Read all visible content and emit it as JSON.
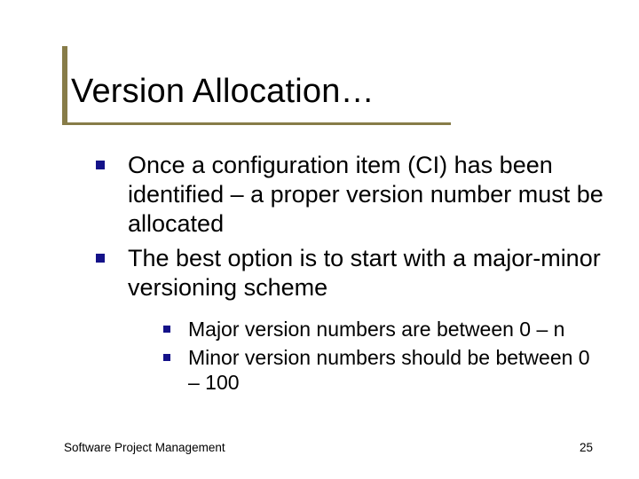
{
  "title": "Version Allocation…",
  "bullets": [
    {
      "text": "Once a configuration item (CI) has been identified – a proper version number must be allocated",
      "children": []
    },
    {
      "text": "The best option is to start with a major-minor versioning scheme",
      "children": [
        {
          "text": "Major version numbers are between 0 – n"
        },
        {
          "text": "Minor version numbers should be between 0 – 100"
        }
      ]
    }
  ],
  "footer": {
    "left": "Software Project Management",
    "right": "25"
  }
}
